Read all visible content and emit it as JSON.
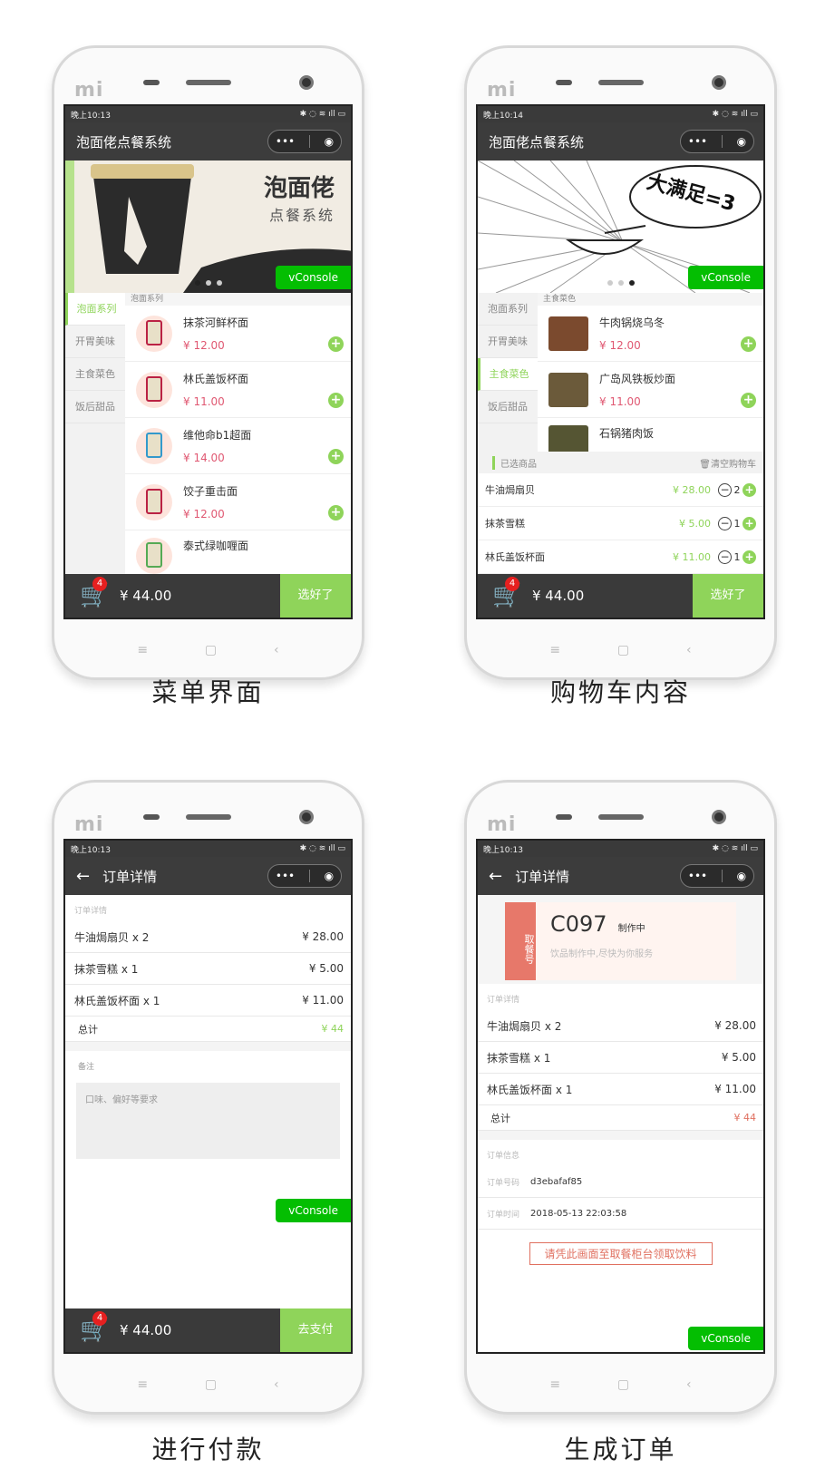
{
  "app_title": "泡面佬点餐系统",
  "order_title": "订单详情",
  "status": {
    "time1": "晚上10:13",
    "time2": "晚上10:14"
  },
  "banner1": {
    "title": "泡面佬",
    "subtitle": "点餐系统"
  },
  "banner2": {
    "title": "大满足=3"
  },
  "vconsole": "vConsole",
  "sidebar": [
    "泡面系列",
    "开胃美味",
    "主食菜色",
    "饭后甜品"
  ],
  "menu1": {
    "category": "泡面系列",
    "items": [
      {
        "name": "抹茶河鲜杯面",
        "price": "¥ 12.00"
      },
      {
        "name": "林氏盖饭杯面",
        "price": "¥ 11.00"
      },
      {
        "name": "维他命b1超面",
        "price": "¥ 14.00"
      },
      {
        "name": "饺子重击面",
        "price": "¥ 12.00"
      },
      {
        "name": "泰式绿咖喱面",
        "price": ""
      }
    ]
  },
  "menu2": {
    "category": "主食菜色",
    "items": [
      {
        "name": "牛肉锅烧乌冬",
        "price": "¥ 12.00"
      },
      {
        "name": "广岛风铁板炒面",
        "price": "¥ 11.00"
      },
      {
        "name": "石锅猪肉饭",
        "price": ""
      }
    ]
  },
  "cart": {
    "header": "已选商品",
    "clear": "清空购物车",
    "items": [
      {
        "name": "牛油焗扇贝",
        "price": "¥ 28.00",
        "qty": "2"
      },
      {
        "name": "抹茶雪糕",
        "price": "¥ 5.00",
        "qty": "1"
      },
      {
        "name": "林氏盖饭杯面",
        "price": "¥ 11.00",
        "qty": "1"
      }
    ],
    "count": "4",
    "total": "¥ 44.00",
    "done": "选好了",
    "pay": "去支付"
  },
  "order": {
    "section": "订单详情",
    "lines": [
      {
        "name": "牛油焗扇贝 x 2",
        "price": "¥ 28.00"
      },
      {
        "name": "抹茶雪糕 x 1",
        "price": "¥ 5.00"
      },
      {
        "name": "林氏盖饭杯面 x 1",
        "price": "¥ 11.00"
      }
    ],
    "total_label": "总计",
    "total": "¥ 44",
    "note_label": "备注",
    "note_placeholder": "口味、偏好等要求"
  },
  "pickup": {
    "label": "取餐号",
    "code": "C097",
    "state": "制作中",
    "tip": "饮品制作中,尽快为你服务",
    "info_section": "订单信息",
    "order_no_label": "订单号码",
    "order_no": "d3ebafaf85",
    "order_time_label": "订单时间",
    "order_time": "2018-05-13 22:03:58",
    "notice": "请凭此画面至取餐柜台领取饮料"
  },
  "captions": [
    "菜单界面",
    "购物车内容",
    "进行付款",
    "生成订单"
  ],
  "colors": {
    "accent": "#8fd45a",
    "price": "#e05872",
    "bar": "#3a3a3a",
    "vconsole": "#04be02"
  }
}
